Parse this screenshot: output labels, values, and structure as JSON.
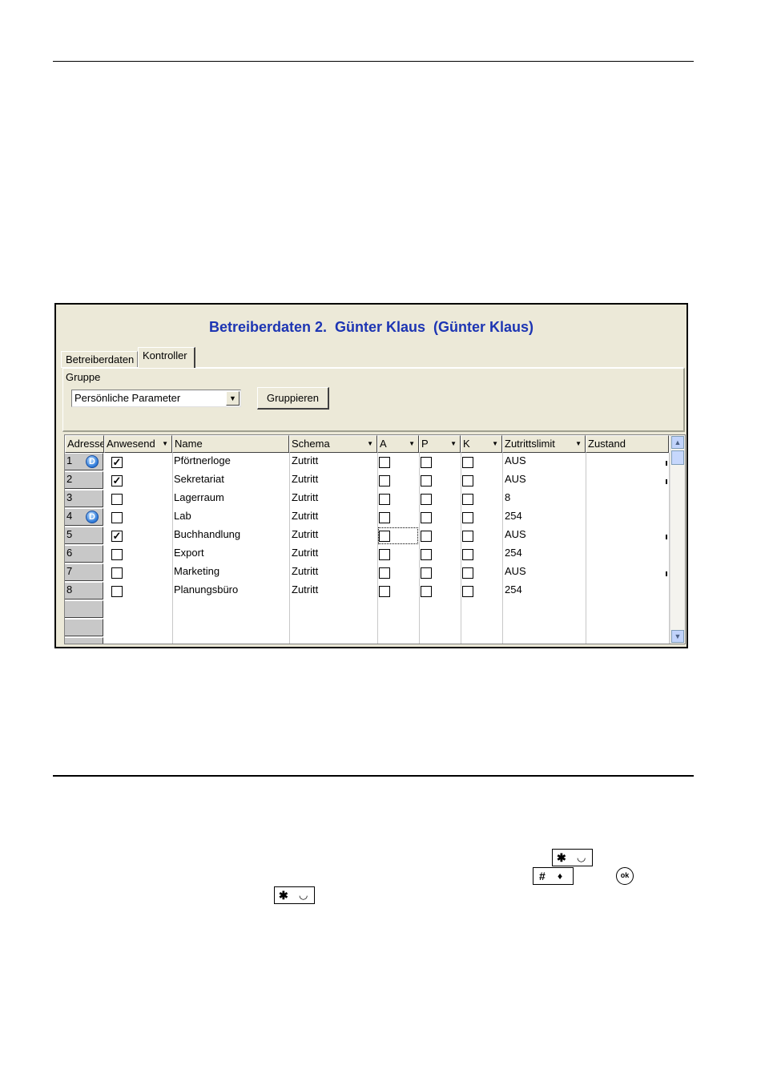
{
  "window": {
    "title": "Betreiberdaten 2.  Günter Klaus  (Günter Klaus)",
    "tabs": [
      {
        "label": "Betreiberdaten"
      },
      {
        "label": "Kontroller"
      }
    ],
    "group_label": "Gruppe",
    "group_select_value": "Persönliche Parameter",
    "group_button": "Gruppieren"
  },
  "grid": {
    "columns": [
      "Adresse",
      "Anwesend",
      "Name",
      "Schema",
      "A",
      "P",
      "K",
      "Zutrittslimit",
      "Zustand"
    ],
    "rows": [
      {
        "address": "1",
        "d_icon": true,
        "present": true,
        "name": "Pförtnerloge",
        "schema": "Zutritt",
        "a": false,
        "p": false,
        "k": false,
        "limit": "AUS"
      },
      {
        "address": "2",
        "d_icon": false,
        "present": true,
        "name": "Sekretariat",
        "schema": "Zutritt",
        "a": false,
        "p": false,
        "k": false,
        "limit": "AUS"
      },
      {
        "address": "3",
        "d_icon": false,
        "present": false,
        "name": "Lagerraum",
        "schema": "Zutritt",
        "a": false,
        "p": false,
        "k": false,
        "limit": "8"
      },
      {
        "address": "4",
        "d_icon": true,
        "present": false,
        "name": "Lab",
        "schema": "Zutritt",
        "a": false,
        "p": false,
        "k": false,
        "limit": "254"
      },
      {
        "address": "5",
        "d_icon": false,
        "present": true,
        "name": "Buchhandlung",
        "schema": "Zutritt",
        "a": false,
        "p": false,
        "k": false,
        "limit": "AUS"
      },
      {
        "address": "6",
        "d_icon": false,
        "present": false,
        "name": "Export",
        "schema": "Zutritt",
        "a": false,
        "p": false,
        "k": false,
        "limit": "254"
      },
      {
        "address": "7",
        "d_icon": false,
        "present": false,
        "name": "Marketing",
        "schema": "Zutritt",
        "a": false,
        "p": false,
        "k": false,
        "limit": "AUS"
      },
      {
        "address": "8",
        "d_icon": false,
        "present": false,
        "name": "Planungsbüro",
        "schema": "Zutritt",
        "a": false,
        "p": false,
        "k": false,
        "limit": "254"
      }
    ],
    "d_icon_glyph": "D",
    "check_glyph": "✓"
  },
  "keys": {
    "star": "✱",
    "hash": "#",
    "ok": "ok"
  }
}
